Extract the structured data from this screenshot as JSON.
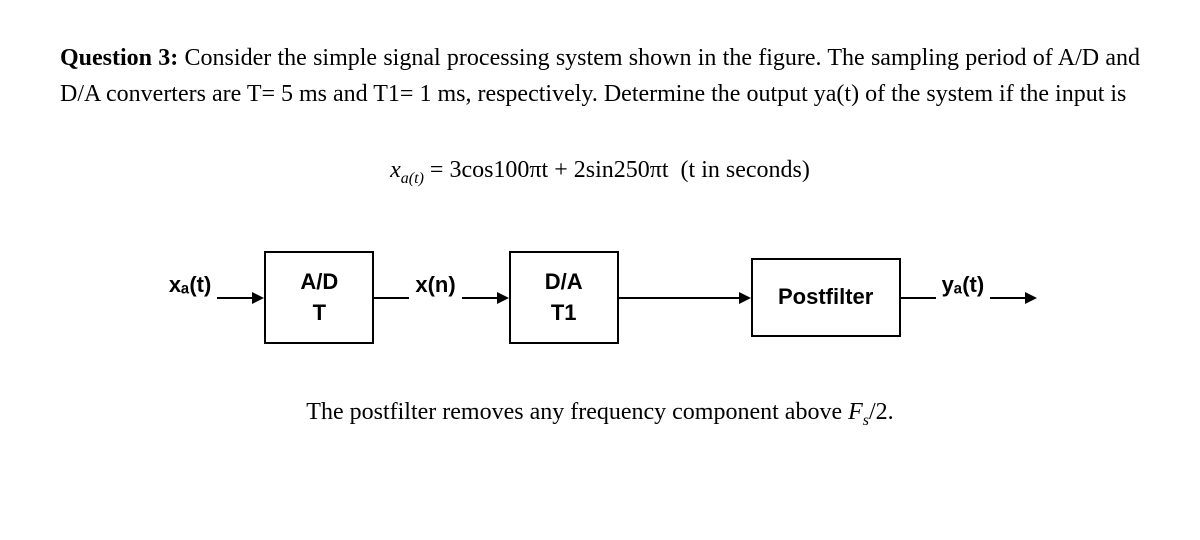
{
  "question": {
    "label": "Question 3:",
    "body": " Consider the simple signal processing system shown in the figure. The sampling period of A/D and D/A converters are T= 5 ms and T1= 1 ms, respectively. Determine the output ya(t) of the system if the input is"
  },
  "equation": {
    "lhs_var": "x",
    "lhs_sub": "a(t)",
    "eq": "= 3cos100πt + 2sin250πt",
    "note": "(t in seconds)"
  },
  "diagram": {
    "input_label": "xₐ(t)",
    "block_ad_top": "A/D",
    "block_ad_bottom": "T",
    "mid_label": "x(n)",
    "block_da_top": "D/A",
    "block_da_bottom": "T1",
    "block_postfilter": "Postfilter",
    "output_label": "yₐ(t)"
  },
  "footer": {
    "text_before": "The postfilter removes any frequency component above   ",
    "var": "F",
    "sub": "s",
    "after": "/2."
  }
}
